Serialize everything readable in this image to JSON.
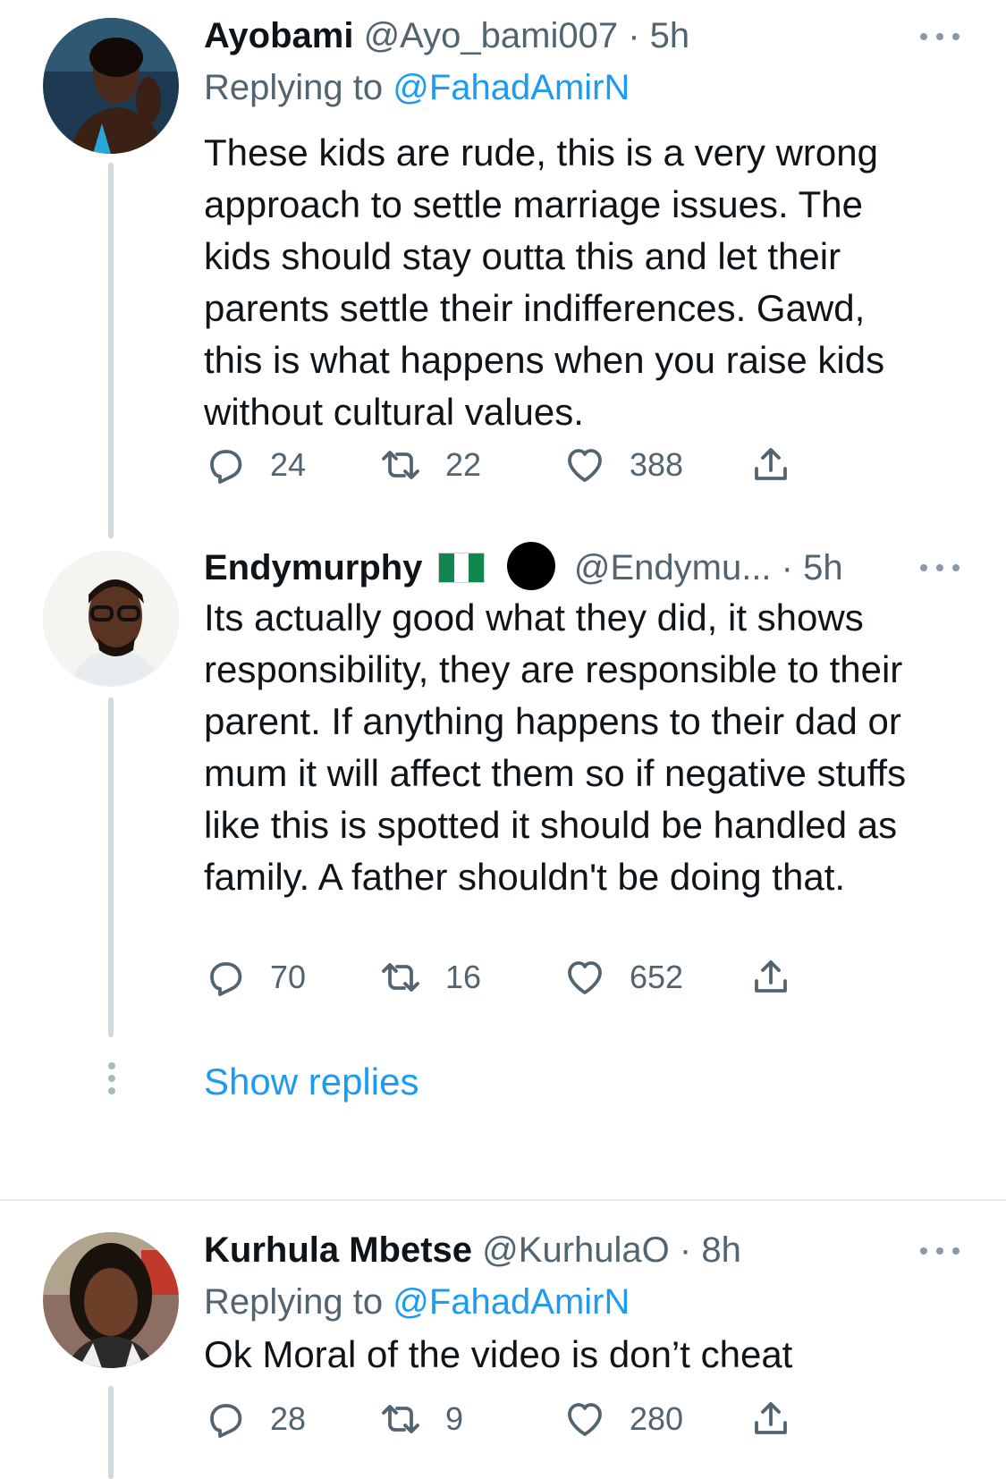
{
  "tweets": [
    {
      "name": "Ayobami",
      "handle": "@Ayo_bami007",
      "separator": "·",
      "time": "5h",
      "replying_prefix": "Replying to",
      "replying_to": "@FahadAmirN",
      "text": "These kids are rude, this is a very wrong approach to settle marriage issues. The kids should stay outta this and let their parents settle their indifferences. Gawd, this is what happens when you raise kids without cultural values.",
      "replies": "24",
      "retweets": "22",
      "likes": "388"
    },
    {
      "name": "Endymurphy",
      "handle": "@Endymu...",
      "separator": "·",
      "time": "5h",
      "text": "Its actually good what they did, it shows responsibility, they are responsible to their parent. If anything happens to their dad or mum it will affect them so if negative stuffs like this is spotted it should be handled as family. A father shouldn't be doing that.",
      "replies": "70",
      "retweets": "16",
      "likes": "652"
    },
    {
      "name": "Kurhula Mbetse",
      "handle": "@KurhulaO",
      "separator": "·",
      "time": "8h",
      "replying_prefix": "Replying to",
      "replying_to": "@FahadAmirN",
      "text": "Ok Moral of the video is don’t cheat",
      "replies": "28",
      "retweets": "9",
      "likes": "280"
    }
  ],
  "show_replies_label": "Show replies",
  "icons": {
    "reply": "reply-icon",
    "retweet": "retweet-icon",
    "like": "heart-icon",
    "share": "share-icon",
    "more": "more-options-icon",
    "flag": "nigeria-flag-icon"
  },
  "colors": {
    "link": "#1d9bf0",
    "secondary_text": "#536471",
    "thread_line": "#cfd9de"
  }
}
